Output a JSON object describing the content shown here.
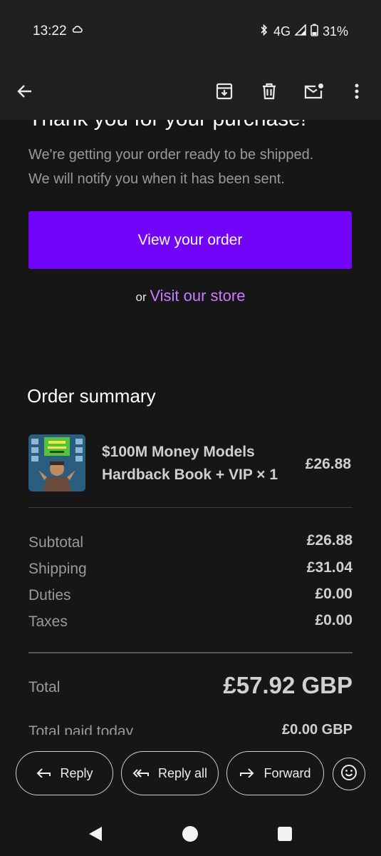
{
  "status": {
    "time": "13:22",
    "network": "4G",
    "battery": "31%"
  },
  "appbar": {
    "icons": [
      "back-arrow-icon",
      "archive-icon",
      "delete-icon",
      "mark-unread-icon",
      "more-vert-icon"
    ]
  },
  "email": {
    "heading": "Thank you for your purchase!",
    "intro_line1": "We're getting your order ready to be shipped.",
    "intro_line2": "We will notify you when it has been sent.",
    "view_order_button": "View your order",
    "or_text": "or",
    "visit_store_link": "Visit our store",
    "accent_color": "#7204fa",
    "link_color": "#c97cff"
  },
  "order_summary": {
    "title": "Order summary",
    "product": {
      "name_line1": "$100M Money Models",
      "name_line2": "Hardback Book + VIP × 1",
      "price": "£26.88"
    },
    "rows": [
      {
        "label": "Subtotal",
        "value": "£26.88"
      },
      {
        "label": "Shipping",
        "value": "£31.04"
      },
      {
        "label": "Duties",
        "value": "£0.00"
      },
      {
        "label": "Taxes",
        "value": "£0.00"
      }
    ],
    "total_label": "Total",
    "total_value": "£57.92 GBP",
    "paid_label": "Total paid today",
    "paid_value": "£0.00 GBP"
  },
  "reply_bar": {
    "reply": "Reply",
    "reply_all": "Reply all",
    "forward": "Forward"
  }
}
